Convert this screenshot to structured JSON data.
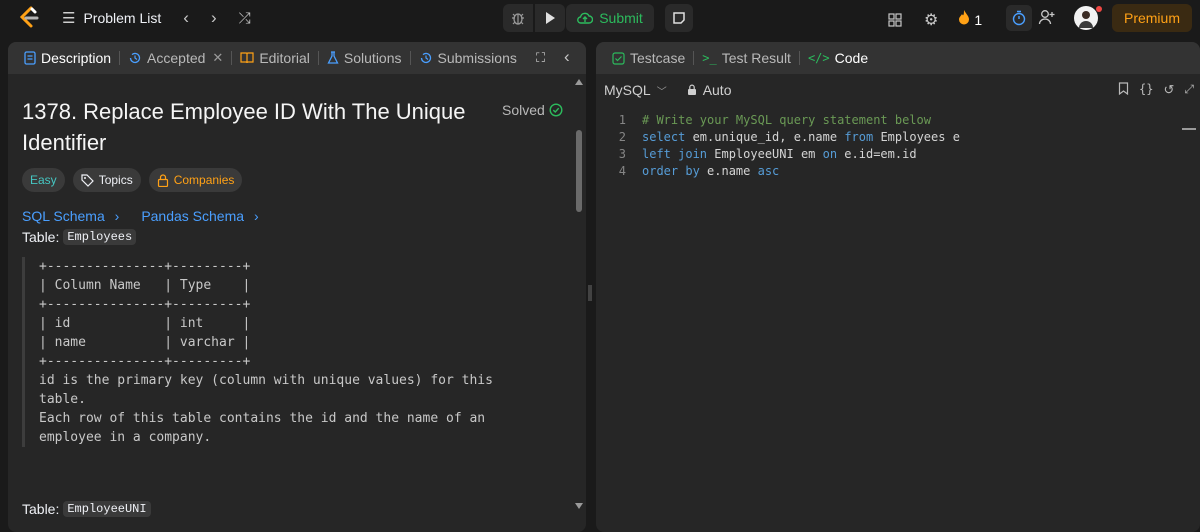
{
  "topbar": {
    "problem_list": "Problem List",
    "submit": "Submit",
    "streak": "1",
    "premium": "Premium"
  },
  "left_tabs": [
    {
      "label": "Description"
    },
    {
      "label": "Accepted"
    },
    {
      "label": "Editorial"
    },
    {
      "label": "Solutions"
    },
    {
      "label": "Submissions"
    }
  ],
  "right_tabs": [
    {
      "label": "Testcase"
    },
    {
      "label": "Test Result"
    },
    {
      "label": "Code"
    }
  ],
  "problem": {
    "title": "1378. Replace Employee ID With The Unique Identifier",
    "status": "Solved",
    "difficulty": "Easy",
    "topics": "Topics",
    "companies": "Companies",
    "sql_schema": "SQL Schema",
    "pandas_schema": "Pandas Schema",
    "table1_label": "Table:",
    "table1_name": "Employees",
    "schema_block": "+---------------+---------+\n| Column Name   | Type    |\n+---------------+---------+\n| id            | int     |\n| name          | varchar |\n+---------------+---------+\nid is the primary key (column with unique values) for this\ntable.\nEach row of this table contains the id and the name of an\nemployee in a company.",
    "table2_label": "Table:",
    "table2_name": "EmployeeUNI"
  },
  "editor": {
    "language": "MySQL",
    "mode": "Auto",
    "lines": [
      {
        "num": "1",
        "parts": [
          {
            "t": "# Write your MySQL query statement below",
            "c": "cm"
          }
        ]
      },
      {
        "num": "2",
        "parts": [
          {
            "t": "select",
            "c": "kw"
          },
          {
            "t": " em.unique_id, e.name ",
            "c": ""
          },
          {
            "t": "from",
            "c": "kw"
          },
          {
            "t": " Employees e",
            "c": ""
          }
        ]
      },
      {
        "num": "3",
        "parts": [
          {
            "t": "left join",
            "c": "kw"
          },
          {
            "t": " EmployeeUNI em ",
            "c": ""
          },
          {
            "t": "on",
            "c": "kw"
          },
          {
            "t": " e.id=em.id",
            "c": ""
          }
        ]
      },
      {
        "num": "4",
        "parts": [
          {
            "t": "order by",
            "c": "kw"
          },
          {
            "t": " e.name ",
            "c": ""
          },
          {
            "t": "asc",
            "c": "kw"
          }
        ]
      }
    ]
  },
  "colors": {
    "accent_green": "#2cbb5d",
    "accent_orange": "#ffa116",
    "link_blue": "#4a9fff",
    "easy_teal": "#46c6c2"
  }
}
